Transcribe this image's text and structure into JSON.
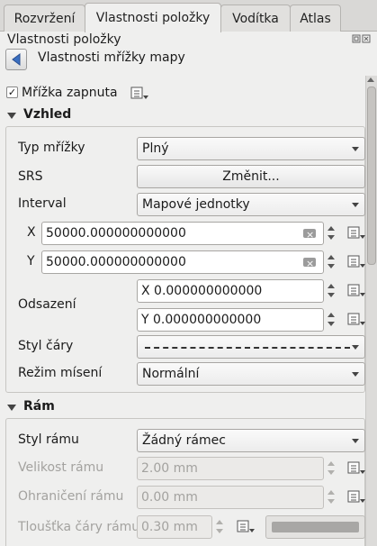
{
  "tabs": [
    "Rozvržení",
    "Vlastnosti položky",
    "Vodítka",
    "Atlas"
  ],
  "panel_title": "Vlastnosti položky",
  "back_label": "Vlastnosti mřížky mapy",
  "grid_enabled": {
    "label": "Mřížka zapnuta",
    "checked": true
  },
  "appearance": {
    "title": "Vzhled",
    "grid_type": {
      "label": "Typ mřížky",
      "value": "Plný"
    },
    "crs": {
      "label": "SRS",
      "button": "Změnit..."
    },
    "interval": {
      "label": "Interval",
      "value": "Mapové jednotky"
    },
    "x": {
      "label": "X",
      "value": "50000.000000000000"
    },
    "y": {
      "label": "Y",
      "value": "50000.000000000000"
    },
    "offset": {
      "label": "Odsazení",
      "x_value": "X 0.000000000000",
      "y_value": "Y 0.000000000000"
    },
    "line_style": {
      "label": "Styl čáry"
    },
    "blend_mode": {
      "label": "Režim mísení",
      "value": "Normální"
    }
  },
  "frame": {
    "title": "Rám",
    "frame_style": {
      "label": "Styl rámu",
      "value": "Žádný rámec"
    },
    "frame_size": {
      "label": "Velikost rámu",
      "value": "2.00 mm"
    },
    "frame_margin": {
      "label": "Ohraničení rámu",
      "value": "0.00 mm"
    },
    "frame_line_thickness": {
      "label": "Tloušťka čáry rámu",
      "value": "0.30 mm"
    }
  },
  "icons": {
    "back": "left-arrow-icon",
    "data_defined": "data-defined-override-icon",
    "clear": "clear-text-icon",
    "float": "undock-icon"
  },
  "colors": {
    "back_arrow": "#3a6fc1",
    "panel_bg": "#efefee"
  }
}
